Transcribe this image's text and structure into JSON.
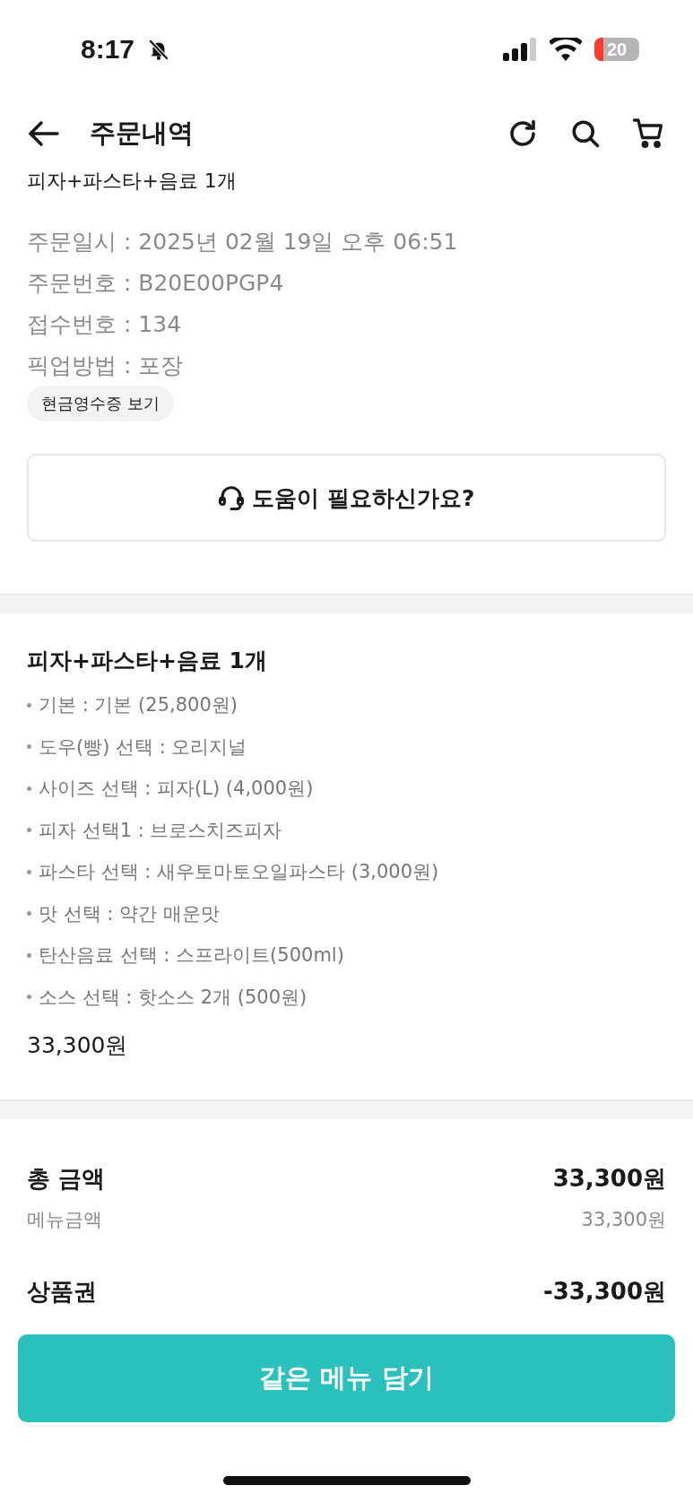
{
  "status_bar": {
    "time": "8:17",
    "battery": "20"
  },
  "header": {
    "title": "주문내역"
  },
  "clipped_item": "피자+파스타+음료 1개",
  "order_info": [
    "주문일시 : 2025년 02월 19일 오후 06:51",
    "주문번호 : B20E00PGP4",
    "접수번호 : 134",
    "픽업방법 : 포장"
  ],
  "receipt_chip": "현금영수증 보기",
  "help_button": "도움이 필요하신가요?",
  "menu": {
    "name": "피자+파스타+음료 1개",
    "options": [
      "기본 : 기본 (25,800원)",
      "도우(빵) 선택 : 오리지널",
      "사이즈 선택 : 피자(L) (4,000원)",
      "피자 선택1 : 브로스치즈피자",
      "파스타 선택 : 새우토마토오일파스타 (3,000원)",
      "맛 선택 : 약간 매운맛",
      "탄산음료 선택 : 스프라이트(500ml)",
      "소스 선택 : 핫소스 2개 (500원)"
    ],
    "price": "33,300원"
  },
  "summary": [
    {
      "kind": "main",
      "label": "총 금액",
      "value": "33,300원"
    },
    {
      "kind": "sub",
      "label": "메뉴금액",
      "value": "33,300원"
    },
    {
      "kind": "main",
      "label": "상품권",
      "value": "-33,300원"
    }
  ],
  "cta_button": "같은 메뉴 담기"
}
